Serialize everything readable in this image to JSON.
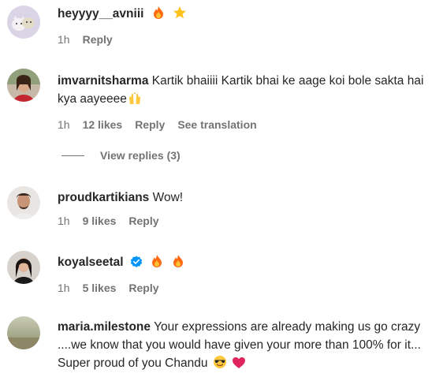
{
  "comments": [
    {
      "username": "heyyyy__avniii",
      "text": "",
      "time": "1h",
      "likes": "",
      "reply": "Reply",
      "emojis": [
        "fire-emoji",
        "star-emoji"
      ]
    },
    {
      "username": "imvarnitsharma",
      "text": "Kartik bhaiiii Kartik bhai ke aage koi bole sakta hai kya aayeeee",
      "time": "1h",
      "likes": "12 likes",
      "reply": "Reply",
      "see_translation": "See translation",
      "emojis": [
        "raising-hands-emoji"
      ]
    },
    {
      "username": "proudkartikians",
      "text": "Wow!",
      "time": "1h",
      "likes": "9 likes",
      "reply": "Reply"
    },
    {
      "username": "koyalseetal",
      "text": "",
      "time": "1h",
      "likes": "5 likes",
      "reply": "Reply",
      "verified": true,
      "emojis": [
        "fire-emoji",
        "fire-emoji"
      ]
    },
    {
      "username": "maria.milestone",
      "text": "Your expressions are already making us go crazy ....we know that you would have given your more than 100% for it... Super proud of you Chandu",
      "emojis": [
        "sunglasses-emoji",
        "red-heart-emoji"
      ]
    }
  ],
  "view_replies": "View replies (3)",
  "colors": {
    "text": "#262626",
    "secondary": "#737373",
    "verified": "#0095f6",
    "fire": "#ff6a13",
    "heart": "#e0245e"
  }
}
